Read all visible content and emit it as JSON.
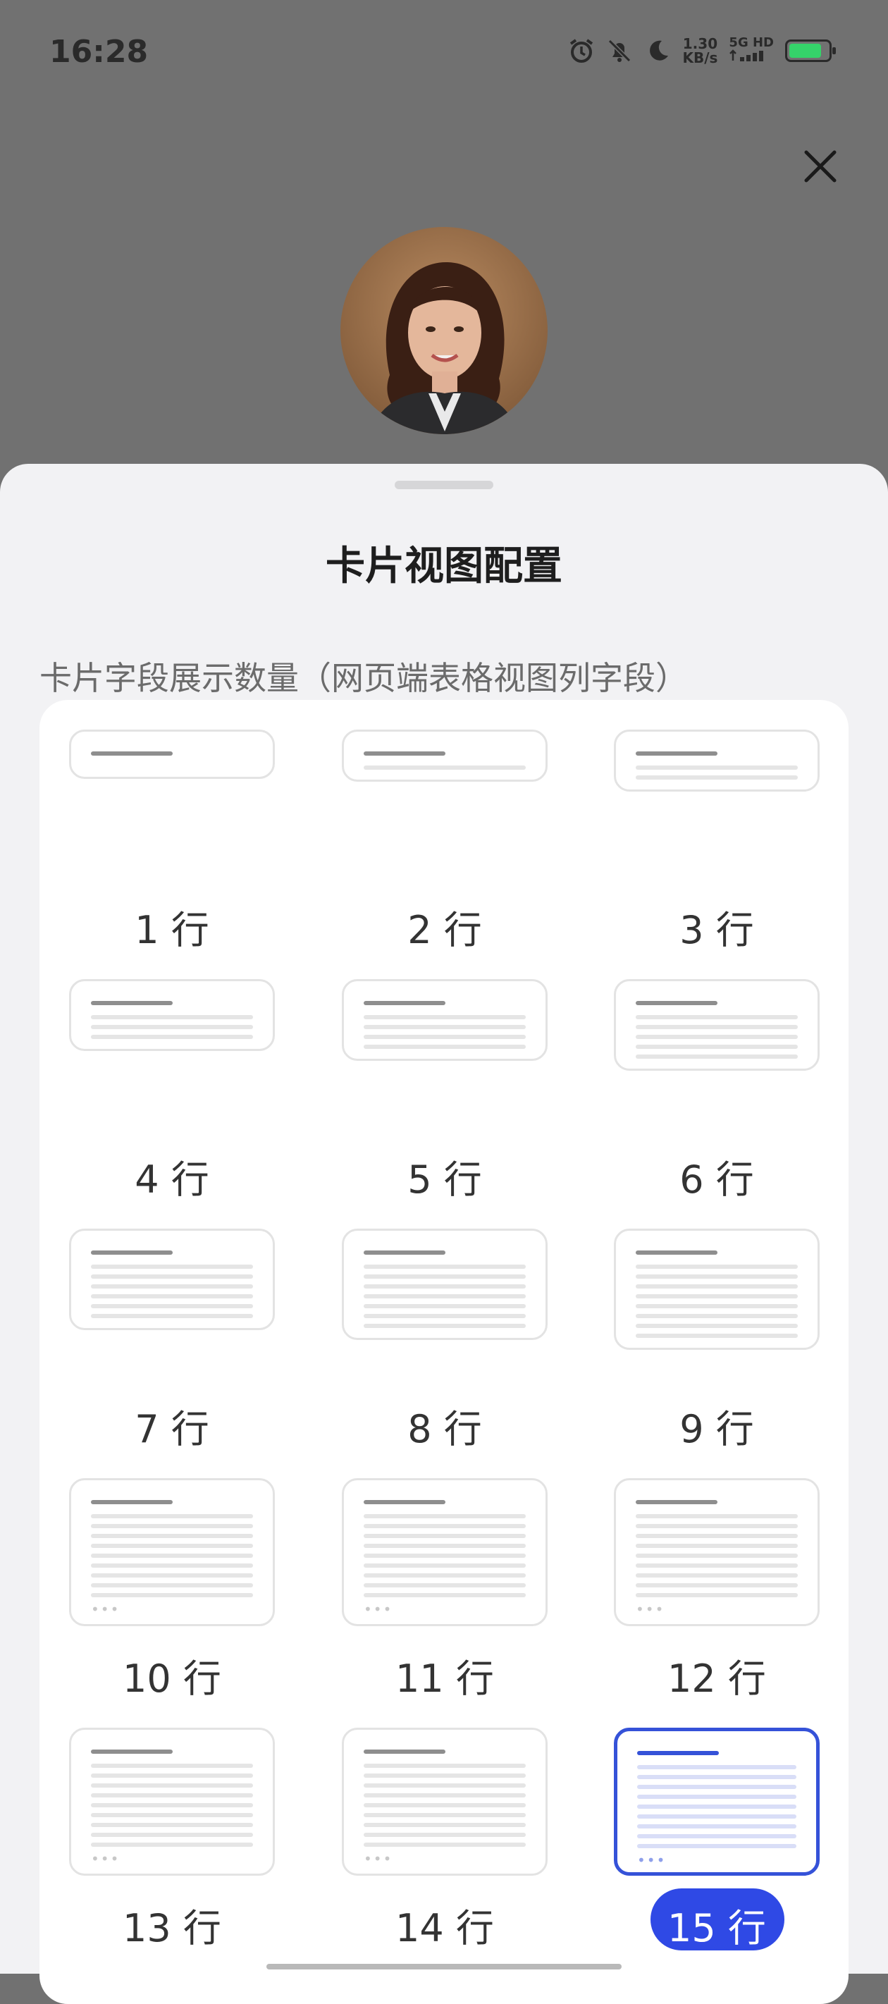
{
  "status_bar": {
    "time": "16:28",
    "speed_value": "1.30",
    "speed_unit": "KB/s",
    "network": "5G HD",
    "battery_color": "#35d36a"
  },
  "sheet": {
    "title": "卡片视图配置",
    "section_label": "卡片字段展示数量（网页端表格视图列字段）",
    "accent_color": "#2f49e5",
    "options": [
      {
        "label": "1 行",
        "rows": 1
      },
      {
        "label": "2 行",
        "rows": 2
      },
      {
        "label": "3 行",
        "rows": 3
      },
      {
        "label": "4 行",
        "rows": 4
      },
      {
        "label": "5 行",
        "rows": 5
      },
      {
        "label": "6 行",
        "rows": 6
      },
      {
        "label": "7 行",
        "rows": 7
      },
      {
        "label": "8 行",
        "rows": 8
      },
      {
        "label": "9 行",
        "rows": 9
      },
      {
        "label": "10 行",
        "rows": 10
      },
      {
        "label": "11 行",
        "rows": 11
      },
      {
        "label": "12 行",
        "rows": 12
      },
      {
        "label": "13 行",
        "rows": 13
      },
      {
        "label": "14 行",
        "rows": 14
      },
      {
        "label": "15 行",
        "rows": 15
      }
    ],
    "selected_index": 14
  }
}
